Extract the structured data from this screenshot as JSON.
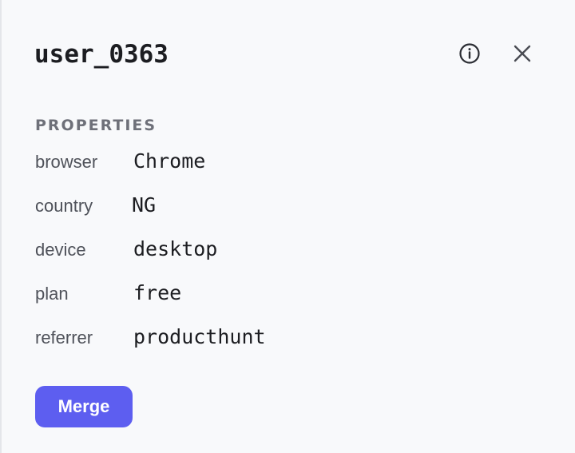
{
  "panel": {
    "title": "user_0363",
    "info_icon": "info-circle-icon",
    "close_icon": "close-icon"
  },
  "properties": {
    "heading": "PROPERTIES",
    "items": [
      {
        "key": "browser",
        "value": "Chrome"
      },
      {
        "key": "country",
        "value": "NG"
      },
      {
        "key": "device",
        "value": "desktop"
      },
      {
        "key": "plan",
        "value": "free"
      },
      {
        "key": "referrer",
        "value": "producthunt"
      }
    ]
  },
  "actions": {
    "merge_label": "Merge"
  },
  "colors": {
    "background": "#f8f9fb",
    "accent": "#5d5ef0",
    "text": "#1c1d21",
    "muted": "#6e7079"
  }
}
